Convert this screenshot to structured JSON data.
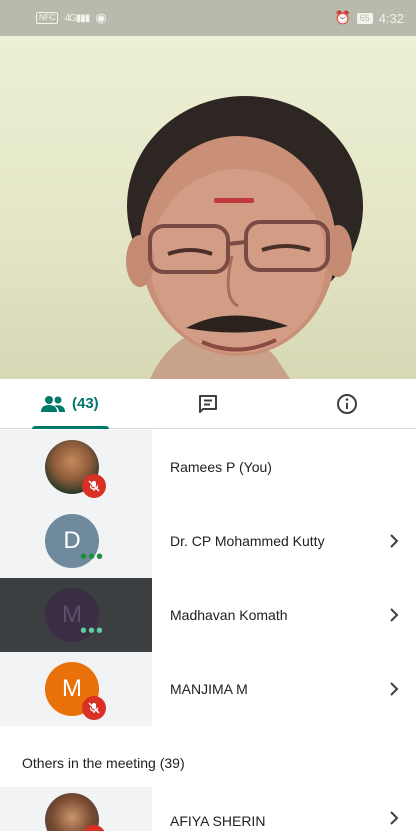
{
  "status_bar": {
    "left_chip": "NFC",
    "signal": "4G",
    "battery": "65",
    "time": "4:32"
  },
  "tabs": {
    "people_count": "(43)"
  },
  "participants": [
    {
      "name": "Ramees P (You)",
      "avatar_type": "photo",
      "muted": true,
      "speaking": false
    },
    {
      "name": "Dr. CP Mohammed Kutty",
      "avatar_letter": "D",
      "muted": false,
      "speaking": true
    },
    {
      "name": "Madhavan Komath",
      "avatar_letter": "M",
      "muted": false,
      "speaking": true,
      "highlighted": true
    },
    {
      "name": "MANJIMA M",
      "avatar_letter": "M",
      "muted": true,
      "speaking": false
    }
  ],
  "others_section": {
    "title": "Others in the meeting (39)",
    "items": [
      {
        "name": "AFIYA SHERIN",
        "avatar_type": "photo"
      }
    ]
  },
  "colors": {
    "accent": "#00796b",
    "mute": "#d93025",
    "speaking": "#1e8e3e"
  }
}
